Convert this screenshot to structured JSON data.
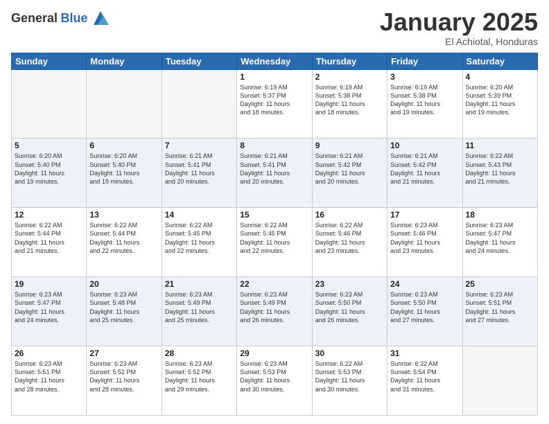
{
  "logo": {
    "general": "General",
    "blue": "Blue"
  },
  "header": {
    "month": "January 2025",
    "location": "El Achiotal, Honduras"
  },
  "weekdays": [
    "Sunday",
    "Monday",
    "Tuesday",
    "Wednesday",
    "Thursday",
    "Friday",
    "Saturday"
  ],
  "weeks": [
    [
      {
        "day": "",
        "info": ""
      },
      {
        "day": "",
        "info": ""
      },
      {
        "day": "",
        "info": ""
      },
      {
        "day": "1",
        "info": "Sunrise: 6:19 AM\nSunset: 5:37 PM\nDaylight: 11 hours\nand 18 minutes."
      },
      {
        "day": "2",
        "info": "Sunrise: 6:19 AM\nSunset: 5:38 PM\nDaylight: 11 hours\nand 18 minutes."
      },
      {
        "day": "3",
        "info": "Sunrise: 6:19 AM\nSunset: 5:38 PM\nDaylight: 11 hours\nand 19 minutes."
      },
      {
        "day": "4",
        "info": "Sunrise: 6:20 AM\nSunset: 5:39 PM\nDaylight: 11 hours\nand 19 minutes."
      }
    ],
    [
      {
        "day": "5",
        "info": "Sunrise: 6:20 AM\nSunset: 5:40 PM\nDaylight: 11 hours\nand 19 minutes."
      },
      {
        "day": "6",
        "info": "Sunrise: 6:20 AM\nSunset: 5:40 PM\nDaylight: 11 hours\nand 19 minutes."
      },
      {
        "day": "7",
        "info": "Sunrise: 6:21 AM\nSunset: 5:41 PM\nDaylight: 11 hours\nand 20 minutes."
      },
      {
        "day": "8",
        "info": "Sunrise: 6:21 AM\nSunset: 5:41 PM\nDaylight: 11 hours\nand 20 minutes."
      },
      {
        "day": "9",
        "info": "Sunrise: 6:21 AM\nSunset: 5:42 PM\nDaylight: 11 hours\nand 20 minutes."
      },
      {
        "day": "10",
        "info": "Sunrise: 6:21 AM\nSunset: 5:42 PM\nDaylight: 11 hours\nand 21 minutes."
      },
      {
        "day": "11",
        "info": "Sunrise: 6:22 AM\nSunset: 5:43 PM\nDaylight: 11 hours\nand 21 minutes."
      }
    ],
    [
      {
        "day": "12",
        "info": "Sunrise: 6:22 AM\nSunset: 5:44 PM\nDaylight: 11 hours\nand 21 minutes."
      },
      {
        "day": "13",
        "info": "Sunrise: 6:22 AM\nSunset: 5:44 PM\nDaylight: 11 hours\nand 22 minutes."
      },
      {
        "day": "14",
        "info": "Sunrise: 6:22 AM\nSunset: 5:45 PM\nDaylight: 11 hours\nand 22 minutes."
      },
      {
        "day": "15",
        "info": "Sunrise: 6:22 AM\nSunset: 5:45 PM\nDaylight: 11 hours\nand 22 minutes."
      },
      {
        "day": "16",
        "info": "Sunrise: 6:22 AM\nSunset: 5:46 PM\nDaylight: 11 hours\nand 23 minutes."
      },
      {
        "day": "17",
        "info": "Sunrise: 6:23 AM\nSunset: 5:46 PM\nDaylight: 11 hours\nand 23 minutes."
      },
      {
        "day": "18",
        "info": "Sunrise: 6:23 AM\nSunset: 5:47 PM\nDaylight: 11 hours\nand 24 minutes."
      }
    ],
    [
      {
        "day": "19",
        "info": "Sunrise: 6:23 AM\nSunset: 5:47 PM\nDaylight: 11 hours\nand 24 minutes."
      },
      {
        "day": "20",
        "info": "Sunrise: 6:23 AM\nSunset: 5:48 PM\nDaylight: 11 hours\nand 25 minutes."
      },
      {
        "day": "21",
        "info": "Sunrise: 6:23 AM\nSunset: 5:49 PM\nDaylight: 11 hours\nand 25 minutes."
      },
      {
        "day": "22",
        "info": "Sunrise: 6:23 AM\nSunset: 5:49 PM\nDaylight: 11 hours\nand 26 minutes."
      },
      {
        "day": "23",
        "info": "Sunrise: 6:23 AM\nSunset: 5:50 PM\nDaylight: 11 hours\nand 26 minutes."
      },
      {
        "day": "24",
        "info": "Sunrise: 6:23 AM\nSunset: 5:50 PM\nDaylight: 11 hours\nand 27 minutes."
      },
      {
        "day": "25",
        "info": "Sunrise: 6:23 AM\nSunset: 5:51 PM\nDaylight: 11 hours\nand 27 minutes."
      }
    ],
    [
      {
        "day": "26",
        "info": "Sunrise: 6:23 AM\nSunset: 5:51 PM\nDaylight: 11 hours\nand 28 minutes."
      },
      {
        "day": "27",
        "info": "Sunrise: 6:23 AM\nSunset: 5:52 PM\nDaylight: 11 hours\nand 28 minutes."
      },
      {
        "day": "28",
        "info": "Sunrise: 6:23 AM\nSunset: 5:52 PM\nDaylight: 11 hours\nand 29 minutes."
      },
      {
        "day": "29",
        "info": "Sunrise: 6:23 AM\nSunset: 5:53 PM\nDaylight: 11 hours\nand 30 minutes."
      },
      {
        "day": "30",
        "info": "Sunrise: 6:22 AM\nSunset: 5:53 PM\nDaylight: 11 hours\nand 30 minutes."
      },
      {
        "day": "31",
        "info": "Sunrise: 6:22 AM\nSunset: 5:54 PM\nDaylight: 11 hours\nand 31 minutes."
      },
      {
        "day": "",
        "info": ""
      }
    ]
  ]
}
